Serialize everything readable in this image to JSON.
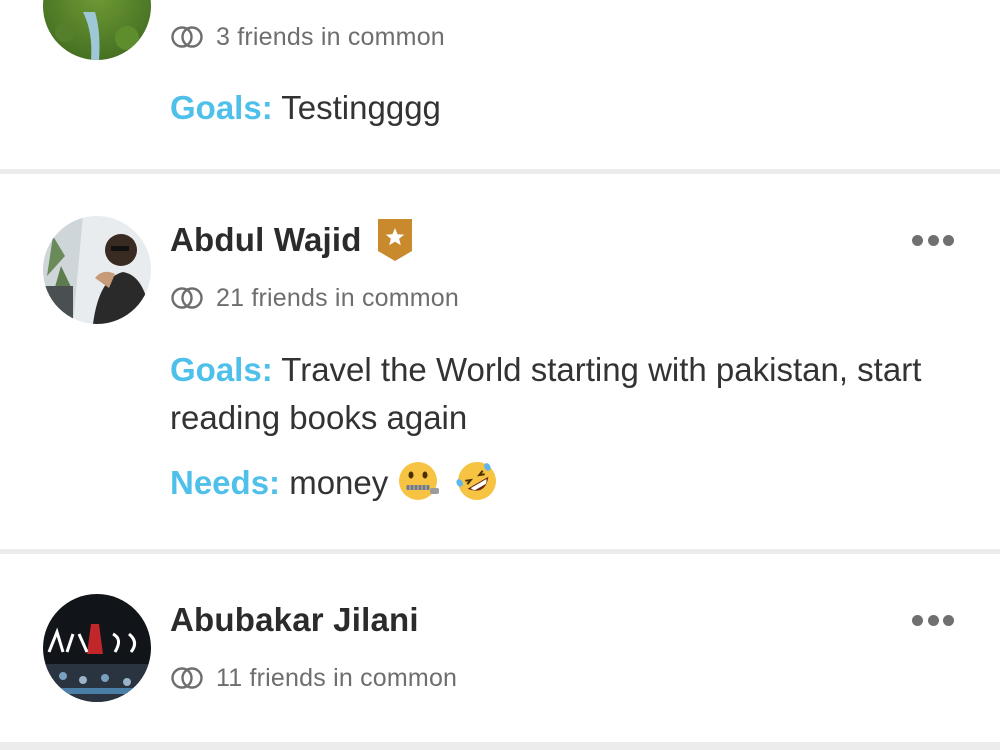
{
  "cards": [
    {
      "friends_text": "3 friends in common",
      "goals_label": "Goals:",
      "goals_text": " Testingggg"
    },
    {
      "name": "Abdul Wajid",
      "friends_text": "21 friends in common",
      "goals_label": "Goals:",
      "goals_text": " Travel the World starting with pakistan, start reading books again",
      "needs_label": "Needs:",
      "needs_text": " money"
    },
    {
      "name": "Abubakar Jilani",
      "friends_text": "11 friends in common"
    }
  ],
  "colors": {
    "label_accent": "#4fc0ea",
    "badge_gold": "#c98a2e",
    "name_text": "#2b2b2b",
    "muted_text": "#6e6e6e"
  },
  "icons": {
    "friends": "overlapping-rings-icon",
    "badge": "star-badge-icon",
    "more": "more-dots-icon",
    "emoji_1": "zipper-mouth-face-emoji",
    "emoji_2": "rolling-on-floor-laughing-emoji"
  }
}
